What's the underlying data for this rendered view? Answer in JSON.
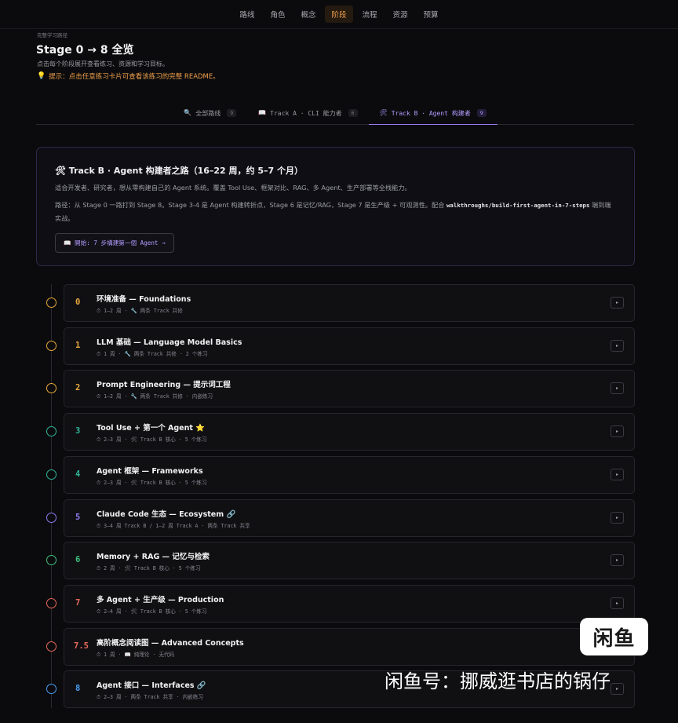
{
  "nav": {
    "items": [
      "路线",
      "角色",
      "概念",
      "阶段",
      "流程",
      "资源",
      "预算"
    ],
    "active": "阶段"
  },
  "breadcrumb": "完整学习路径",
  "page": {
    "title": "Stage 0 → 8 全览",
    "subtitle": "点击每个阶段展开查看练习、资源和学习目标。",
    "tip": "提示：点击任意练习卡片可查看该练习的完整 README。"
  },
  "tabs": [
    {
      "icon": "🔍",
      "label": "全部路线",
      "count": "9"
    },
    {
      "icon": "📖",
      "label": "Track A · CLI 能力者",
      "count": "6"
    },
    {
      "icon": "🛠",
      "label": "Track B · Agent 构建者",
      "count": "9"
    }
  ],
  "intro": {
    "title": "🛠 Track B · Agent 构建者之路（16–22 周，约 5–7 个月）",
    "p1": "适合开发者、研究者，想从零构建自己的 Agent 系统。覆盖 Tool Use、框架对比、RAG、多 Agent、生产部署等全栈能力。",
    "p2_pre": "路径：从 Stage 0 一路打到 Stage 8。Stage 3-4 是 Agent 构建转折点，Stage 6 是记忆/RAG，Stage 7 是生产级 + 可观测性。配合 ",
    "p2_code": "walkthroughs/build-first-agent-in-7-steps",
    "p2_post": " 端到端实战。",
    "button": "📖 開始: 7 步構建第一個 Agent →"
  },
  "stages": [
    {
      "num": "0",
      "title": "环境准备 — Foundations",
      "meta": "⏱ 1–2 周 · 🔧 两条 Track 共修"
    },
    {
      "num": "1",
      "title": "LLM 基础 — Language Model Basics",
      "meta": "⏱ 1 周 · 🔧 两条 Track 共修 · 2 个练习"
    },
    {
      "num": "2",
      "title": "Prompt Engineering — 提示词工程",
      "meta": "⏱ 1–2 周 · 🔧 两条 Track 共修 · 内嵌练习"
    },
    {
      "num": "3",
      "title": "Tool Use + 第一个 Agent ⭐",
      "meta": "⏱ 2–3 周 · 🛠 Track B 核心 · 5 个练习"
    },
    {
      "num": "4",
      "title": "Agent 框架 — Frameworks",
      "meta": "⏱ 2–3 周 · 🛠 Track B 核心 · 5 个练习"
    },
    {
      "num": "5",
      "title": "Claude Code 生态 — Ecosystem 🔗",
      "meta": "⏱ 3–4 周 Track B / 1–2 周 Track A · 两条 Track 共享"
    },
    {
      "num": "6",
      "title": "Memory + RAG — 记忆与检索",
      "meta": "⏱ 2 周 · 🛠 Track B 核心 · 5 个练习"
    },
    {
      "num": "7",
      "title": "多 Agent + 生产级 — Production",
      "meta": "⏱ 2–4 周 · 🛠 Track B 核心 · 5 个练习"
    },
    {
      "num": "7.5",
      "title": "高阶概念阅读图 — Advanced Concepts",
      "meta": "⏱ 1 周 · 📖 纯理论 · 无代码"
    },
    {
      "num": "8",
      "title": "Agent 接口 — Interfaces 🔗",
      "meta": "⏱ 2–3 周 · 两条 Track 共享 · 内嵌练习"
    }
  ],
  "stage_colors": [
    "#e8a93c",
    "#e8a93c",
    "#e8a93c",
    "#2fb59a",
    "#2fb59a",
    "#8f7cf0",
    "#3fc07f",
    "#e86a5a",
    "#e86a5a",
    "#4a9cf0"
  ],
  "expand_glyph": "▸",
  "watermark": {
    "logo": "闲鱼",
    "text": "闲鱼号：挪威逛书店的锅仔"
  }
}
